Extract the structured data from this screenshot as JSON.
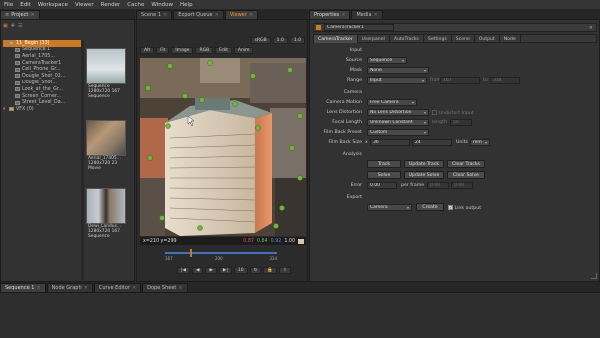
{
  "menu": [
    "File",
    "Edit",
    "Workspace",
    "Viewer",
    "Render",
    "Cache",
    "Window",
    "Help"
  ],
  "tabs_left": [
    {
      "label": "Project",
      "active": true
    }
  ],
  "tabs_mid": [
    {
      "label": "Scene 1",
      "active": false
    },
    {
      "label": "Export Queue",
      "active": false
    },
    {
      "label": "Viewer",
      "active": true
    }
  ],
  "tabs_props": [
    {
      "label": "Properties",
      "active": true
    },
    {
      "label": "Media",
      "active": false
    }
  ],
  "tabs_bottom": [
    {
      "label": "Sequence 1",
      "active": true
    },
    {
      "label": "Node Graph",
      "active": false
    },
    {
      "label": "Curve Editor",
      "active": false
    },
    {
      "label": "Dope Sheet",
      "active": false
    }
  ],
  "project": {
    "rows": [
      {
        "label": "11_Begin (33)",
        "indent": 0,
        "selected": true
      },
      {
        "label": "Sequence 1",
        "indent": 1,
        "selected": false
      },
      {
        "label": "Aerial_1705...",
        "indent": 1,
        "selected": false
      },
      {
        "label": "CameraTracker1",
        "indent": 1,
        "selected": false
      },
      {
        "label": "Cell_Phone_Gr...",
        "indent": 1,
        "selected": false
      },
      {
        "label": "Dougie_Shot_02...",
        "indent": 1,
        "selected": false
      },
      {
        "label": "Dougie_Shot...",
        "indent": 1,
        "selected": false
      },
      {
        "label": "Look_at_the_Gr...",
        "indent": 1,
        "selected": false
      },
      {
        "label": "Screen_Corner...",
        "indent": 1,
        "selected": false
      },
      {
        "label": "Street_Level_Da...",
        "indent": 1,
        "selected": false
      },
      {
        "label": "VFX (0)",
        "indent": 0,
        "selected": false
      }
    ],
    "thumbs": [
      {
        "name": "Sequence",
        "res": "1280x720",
        "frames": "167",
        "type": "Sequence"
      },
      {
        "name": "Aerial_17405...",
        "res": "1280x720",
        "frames": "23",
        "type": "Movie"
      },
      {
        "name": "Dewi_Landus...",
        "res": "1280x720",
        "frames": "167",
        "type": "Sequence"
      }
    ]
  },
  "viewer": {
    "toolbar": [
      "Alt",
      "Fit",
      "Image",
      "RGB",
      "Edit",
      "Anim"
    ],
    "toolbar_right": [
      "sRGB",
      "1.0",
      "1.0"
    ],
    "coords": "x=210 y=299",
    "values": {
      "r": "0.87",
      "g": "0.84",
      "b": "0.92",
      "a": "1.00"
    },
    "timeline": {
      "start": "167",
      "mid": "200",
      "end": "334"
    },
    "frame": "10"
  },
  "props": {
    "node_name": "CameraTracker1",
    "tabs": [
      "CameraTracker",
      "Userpanel",
      "AutoTracks",
      "Settings",
      "Scene",
      "Output",
      "Node"
    ],
    "input_header": "Input",
    "source_label": "Source",
    "source_value": "Sequence",
    "mask_label": "Mask",
    "mask_value": "None",
    "range_label": "Range",
    "range_value": "Input",
    "range_from_label": "from",
    "range_from": "167",
    "range_to_label": "to",
    "range_to": "334",
    "camera_header": "Camera",
    "motion_label": "Camera Motion",
    "motion_value": "Free Camera",
    "lens_label": "Lens Distortion",
    "lens_value": "No Lens Distortion",
    "undistort_label": "Undistort Input",
    "focal_label": "Focal Length",
    "focal_value": "Unknown Constant",
    "focal_len_label": "length",
    "focal_len": "50",
    "film_label": "Film Back Preset",
    "film_value": "Custom",
    "filmsize_label": "Film Back Size",
    "filmsize_x_label": "x",
    "filmsize_x": "36",
    "filmsize_y": "24",
    "units_label": "Units",
    "units_value": "mm",
    "analysis_header": "Analysis",
    "btn_track": "Track",
    "btn_update_track": "Update Track",
    "btn_clear_tracks": "Clear Tracks",
    "btn_solve": "Solve",
    "btn_update_solve": "Update Solve",
    "btn_clear_solve": "Clear Solve",
    "error_label": "Error",
    "error_value": "0.00",
    "per_frame_label": "per frame",
    "per_frame_value": "0.00",
    "per_frame_value2": "0.00",
    "export_header": "Export",
    "export_value": "Camera",
    "btn_create": "Create",
    "link_output_label": "Link output",
    "link_output_checked": true
  },
  "colors": {
    "accent": "#d07820",
    "bg": "#2a2a2a"
  }
}
